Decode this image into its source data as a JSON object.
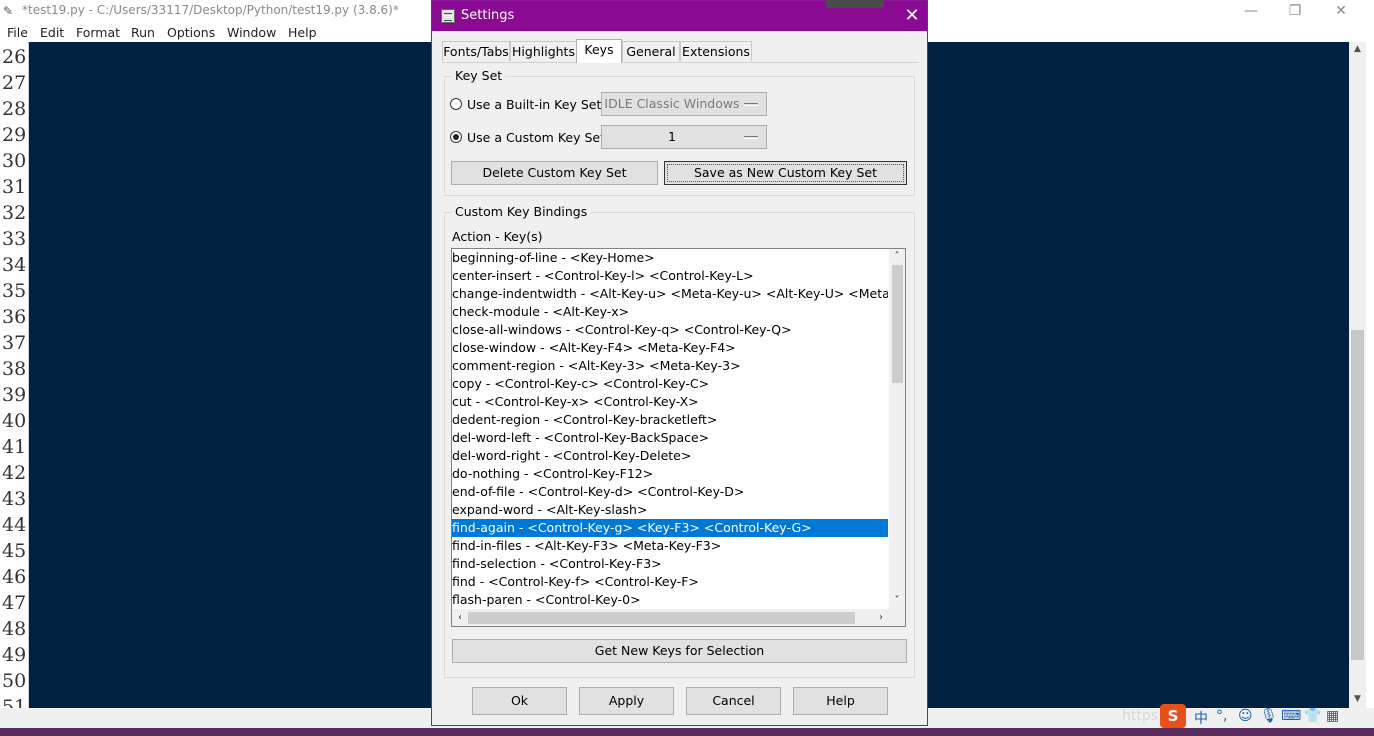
{
  "editor": {
    "title": "*test19.py - C:/Users/33117/Desktop/Python/test19.py (3.8.6)*",
    "menu": [
      "File",
      "Edit",
      "Format",
      "Run",
      "Options",
      "Window",
      "Help"
    ],
    "line_numbers": [
      "26",
      "27",
      "28",
      "29",
      "30",
      "31",
      "32",
      "33",
      "34",
      "35",
      "36",
      "37",
      "38",
      "39",
      "40",
      "41",
      "42",
      "43",
      "44",
      "45",
      "46",
      "47",
      "48",
      "49",
      "50",
      "51"
    ],
    "window_controls": {
      "minimize": "—",
      "maximize": "❐",
      "close": "✕"
    },
    "code_background": "#002240"
  },
  "tray": {
    "watermark": "https://",
    "sogou": "S",
    "items": [
      "中",
      "°,",
      "☺",
      "🎙",
      "⌨",
      "👕",
      "▦"
    ]
  },
  "dialog": {
    "title": "Settings",
    "close": "✕",
    "title_color": "#8b0a93",
    "tabs": [
      "Fonts/Tabs",
      "Highlights",
      "Keys",
      "General",
      "Extensions"
    ],
    "active_tab": "Keys",
    "key_set": {
      "group_label": "Key Set",
      "builtin_label": "Use a Built-in Key Set",
      "builtin_value": "IDLE Classic Windows",
      "custom_label": "Use a Custom Key Set",
      "custom_value": "1",
      "delete_button": "Delete Custom Key Set",
      "save_button": "Save as New Custom Key Set"
    },
    "bindings": {
      "group_label": "Custom Key Bindings",
      "list_header": "Action - Key(s)",
      "selected_index": 15,
      "items": [
        "beginning-of-line - <Key-Home>",
        "center-insert - <Control-Key-l> <Control-Key-L>",
        "change-indentwidth - <Alt-Key-u> <Meta-Key-u> <Alt-Key-U> <Meta-Key-U>",
        "check-module - <Alt-Key-x>",
        "close-all-windows - <Control-Key-q> <Control-Key-Q>",
        "close-window - <Alt-Key-F4> <Meta-Key-F4>",
        "comment-region - <Alt-Key-3> <Meta-Key-3>",
        "copy - <Control-Key-c> <Control-Key-C>",
        "cut - <Control-Key-x> <Control-Key-X>",
        "dedent-region - <Control-Key-bracketleft>",
        "del-word-left - <Control-Key-BackSpace>",
        "del-word-right - <Control-Key-Delete>",
        "do-nothing - <Control-Key-F12>",
        "end-of-file - <Control-Key-d> <Control-Key-D>",
        "expand-word - <Alt-Key-slash>",
        "find-again - <Control-Key-g> <Key-F3> <Control-Key-G>",
        "find-in-files - <Alt-Key-F3> <Meta-Key-F3>",
        "find-selection - <Control-Key-F3>",
        "find - <Control-Key-f> <Control-Key-F>",
        "flash-paren - <Control-Key-0>"
      ],
      "get_new_keys_button": "Get New Keys for Selection"
    },
    "footer": {
      "ok": "Ok",
      "apply": "Apply",
      "cancel": "Cancel",
      "help": "Help"
    },
    "selection_color": "#0078d7"
  }
}
